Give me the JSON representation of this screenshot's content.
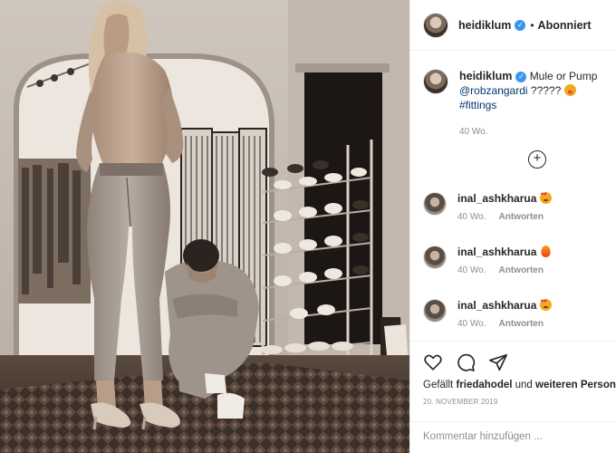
{
  "post": {
    "image_alt": "Photo of a woman in jeans standing while a man kneels in front of a shoe rack",
    "colors": {
      "accent": "#3897f0",
      "link": "#00376b",
      "muted": "#8e8e8e",
      "text": "#262626"
    }
  },
  "header": {
    "username": "heidiklum",
    "verified_icon": "verified-badge-icon",
    "separator": "•",
    "follow_label": "Abonniert"
  },
  "caption": {
    "username": "heidiklum",
    "text_part1": "Mule or Pump",
    "mention": "@robzangardi",
    "text_part2": "?????",
    "emoji": "face-with-tongue",
    "hashtag": "#fittings",
    "time": "40 Wo."
  },
  "load_more_icon": "plus-circle-icon",
  "comments": [
    {
      "username": "inal_ashkharua",
      "emoji": "smiling-face-with-heart-eyes",
      "time": "40 Wo.",
      "reply_label": "Antworten"
    },
    {
      "username": "inal_ashkharua",
      "emoji": "fire",
      "time": "40 Wo.",
      "reply_label": "Antworten"
    },
    {
      "username": "inal_ashkharua",
      "emoji": "smiling-face-with-heart-eyes",
      "time": "40 Wo.",
      "reply_label": "Antworten"
    }
  ],
  "actions": {
    "icons": [
      "heart-icon",
      "comment-icon",
      "share-icon"
    ],
    "likes_prefix": "Gefällt",
    "likes_user": "friedahodel",
    "likes_and": "und",
    "likes_rest": "weiteren Personen",
    "date": "20. NOVEMBER 2019"
  },
  "comment_input": {
    "placeholder": "Kommentar hinzufügen ..."
  }
}
